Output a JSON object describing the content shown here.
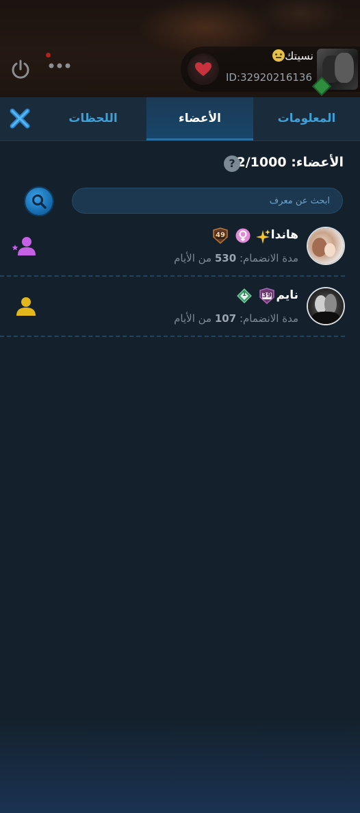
{
  "header": {
    "room_name": "نسيتك",
    "room_id": "ID:32920216136"
  },
  "tabs": [
    {
      "label": "المعلومات",
      "active": false
    },
    {
      "label": "الأعضاء",
      "active": true
    },
    {
      "label": "اللحظات",
      "active": false
    }
  ],
  "members_header": {
    "label": "الأعضاء:",
    "count": "2/1000",
    "help": "?"
  },
  "search": {
    "placeholder": "ابحث عن معرف"
  },
  "members": [
    {
      "name": "هاندا",
      "level": "49",
      "days_prefix": "مدة الانضمام:",
      "days": "530",
      "days_suffix": "من الأيام",
      "role_icon": "admin-star-user-icon"
    },
    {
      "name": "نايم",
      "level": "39",
      "gem_level": "1",
      "days_prefix": "مدة الانضمام:",
      "days": "107",
      "days_suffix": "من الأيام",
      "role_icon": "owner-user-icon"
    }
  ],
  "colors": {
    "accent": "#3fa0d8",
    "active_tab": "#17466b",
    "background": "#14212c",
    "admin": "#c661e6",
    "owner": "#e4b81c"
  }
}
